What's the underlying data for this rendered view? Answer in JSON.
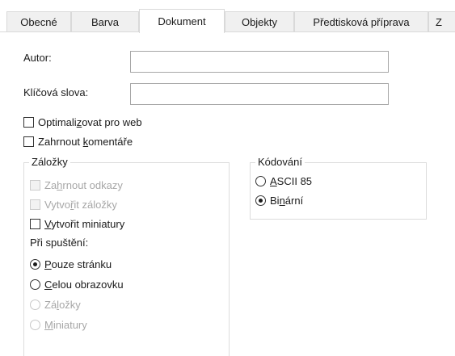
{
  "tabs": [
    {
      "label": "Obecné"
    },
    {
      "label": "Barva"
    },
    {
      "label": "Dokument"
    },
    {
      "label": "Objekty"
    },
    {
      "label": "Předtisková příprava"
    },
    {
      "label": "Z"
    }
  ],
  "fields": {
    "author_label": "Autor:",
    "author_value": "",
    "keywords_label": "Klíčová slova:",
    "keywords_value": ""
  },
  "options": {
    "optimize_web": {
      "pre": "Optimali",
      "u": "z",
      "post": "ovat pro web",
      "checked": false
    },
    "include_comments": {
      "pre": "Zahrnout ",
      "u": "k",
      "post": "omentáře",
      "checked": false
    }
  },
  "bookmarks_group": {
    "title": "Záložky",
    "include_links": {
      "pre": "Za",
      "u": "h",
      "post": "rnout odkazy",
      "disabled": true
    },
    "create_bookmarks": {
      "pre": "Vytvo",
      "u": "ř",
      "post": "it záložky",
      "disabled": true
    },
    "create_thumbnails": {
      "pre": "",
      "u": "V",
      "post": "ytvořit miniatury",
      "disabled": false
    },
    "on_start_label": "Při spuštění:",
    "page_only": {
      "pre": "",
      "u": "P",
      "post": "ouze stránku",
      "selected": true
    },
    "full_screen": {
      "pre": "",
      "u": "C",
      "post": "elou obrazovku",
      "selected": false
    },
    "bookmarks": {
      "pre": "Zá",
      "u": "l",
      "post": "ožky",
      "disabled": true
    },
    "thumbnails": {
      "pre": "",
      "u": "M",
      "post": "iniatury",
      "disabled": true
    }
  },
  "encoding_group": {
    "title": "Kódování",
    "ascii85": {
      "pre": "",
      "u": "A",
      "post": "SCII 85",
      "selected": false
    },
    "binary": {
      "pre": "Bi",
      "u": "n",
      "post": "ární",
      "selected": true
    }
  }
}
